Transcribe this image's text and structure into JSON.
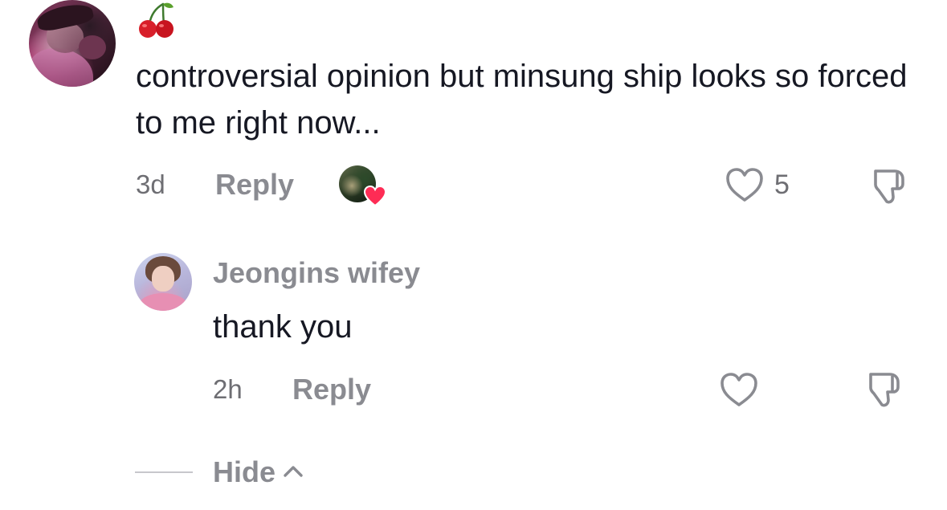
{
  "comment": {
    "sticker": "cherry-sticker",
    "text": "controversial opinion but minsung ship looks so forced to me right now...",
    "time": "3d",
    "reply_label": "Reply",
    "creator_liked": true,
    "likes": "5",
    "heart_color": "#fe2c55"
  },
  "reply": {
    "author": "Jeongins wifey",
    "text": "thank you",
    "time": "2h",
    "reply_label": "Reply"
  },
  "thread": {
    "hide_label": "Hide"
  },
  "icons": {
    "like": "heart-outline-icon",
    "dislike": "thumbs-down-icon",
    "collapse": "chevron-up-icon"
  }
}
